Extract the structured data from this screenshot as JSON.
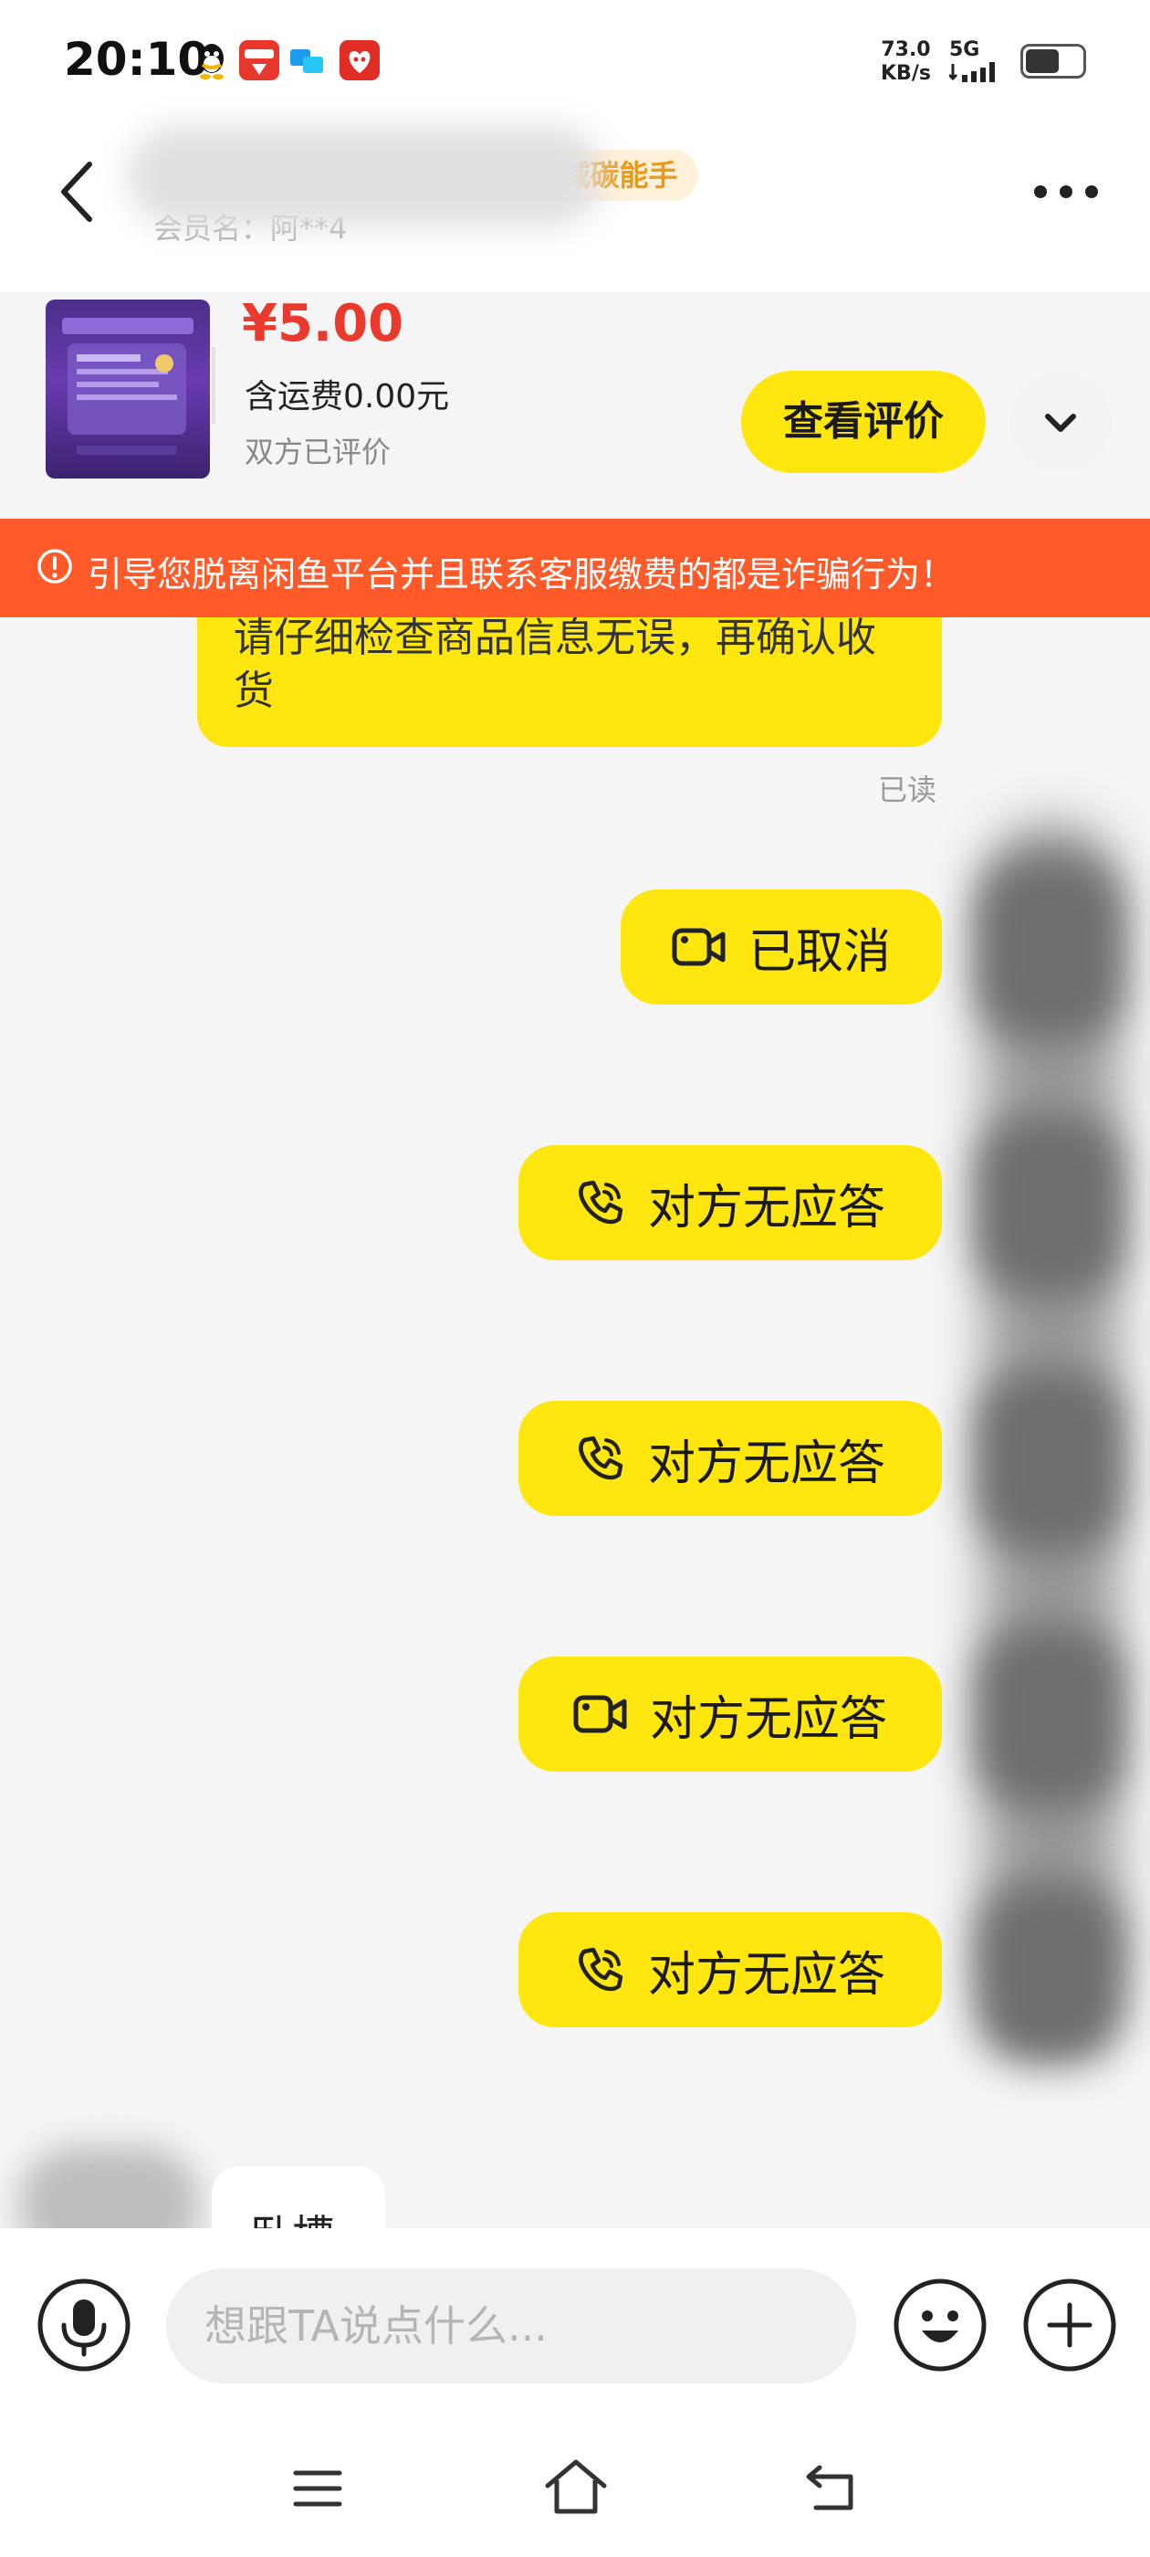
{
  "status_bar": {
    "time": "20:10",
    "net_speed_value": "73.0",
    "net_speed_unit": "KB/s",
    "network": "5G",
    "battery_level": 0.6,
    "app_icons": [
      "qq-icon",
      "alipay-icon",
      "message-icon",
      "pinduoduo-icon"
    ]
  },
  "header": {
    "member_name": "会员名：阿**4",
    "badge": "减碳能手"
  },
  "product": {
    "price": "¥5.00",
    "shipping": "含运费0.00元",
    "review_status": "双方已评价",
    "review_button": "查看评价"
  },
  "banner": {
    "text": "引导您脱离闲鱼平台并且联系客服缴费的都是诈骗行为！"
  },
  "messages": {
    "text_bubble": "请仔细检查商品信息无误，再确认收货",
    "read_label": "已读",
    "calls": [
      {
        "type": "video",
        "label": "已取消"
      },
      {
        "type": "voice",
        "label": "对方无应答"
      },
      {
        "type": "voice",
        "label": "对方无应答"
      },
      {
        "type": "video",
        "label": "对方无应答"
      },
      {
        "type": "voice",
        "label": "对方无应答"
      }
    ],
    "incoming_text": "卧槽"
  },
  "input": {
    "placeholder": "想跟TA说点什么..."
  },
  "colors": {
    "accent_yellow": "#ffe60f",
    "price_red": "#ea3a2e",
    "banner_orange": "#ff5a2a"
  }
}
